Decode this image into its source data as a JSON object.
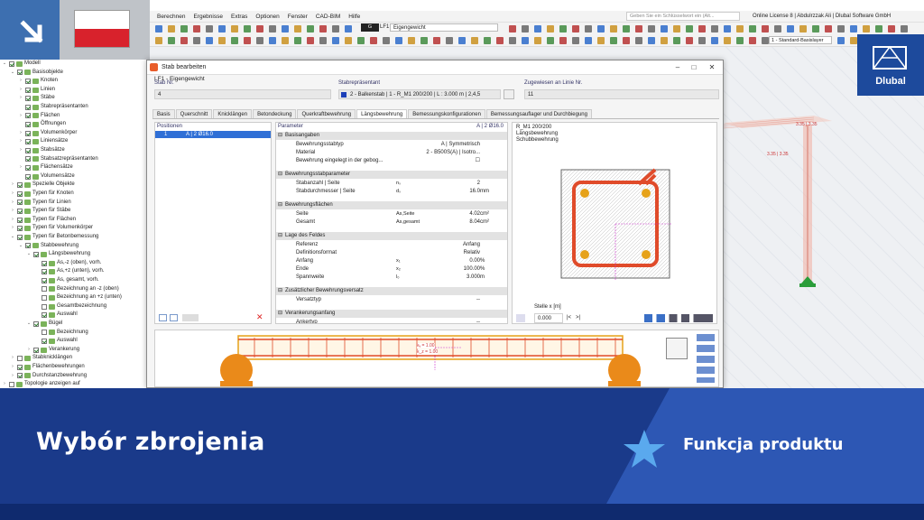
{
  "menu": [
    "Berechnen",
    "Ergebnisse",
    "Extras",
    "Optionen",
    "Fenster",
    "CAD-BIM",
    "Hilfe"
  ],
  "search_placeholder": "Geben Sie ein Schlüsselwort ein (Alt...",
  "license": "Online License 8 | Abdulrzzak Ali | Dlubal Software GmbH",
  "loadcase": {
    "code": "G",
    "name": "LF1",
    "description": "Eigengewicht"
  },
  "basislayer": "1 - Standard-Basislayer",
  "logo_text": "Dlubal",
  "tree": [
    {
      "label": "Modell",
      "level": 0,
      "exp": "v",
      "checked": true
    },
    {
      "label": "Basisobjekte",
      "level": 1,
      "exp": "v",
      "checked": true
    },
    {
      "label": "Knoten",
      "level": 2,
      "exp": ">",
      "checked": true
    },
    {
      "label": "Linien",
      "level": 2,
      "exp": ">",
      "checked": true
    },
    {
      "label": "Stäbe",
      "level": 2,
      "exp": ">",
      "checked": true
    },
    {
      "label": "Stabrepräsentanten",
      "level": 2,
      "exp": "",
      "checked": true
    },
    {
      "label": "Flächen",
      "level": 2,
      "exp": ">",
      "checked": true
    },
    {
      "label": "Öffnungen",
      "level": 2,
      "exp": "",
      "checked": true
    },
    {
      "label": "Volumenkörper",
      "level": 2,
      "exp": ">",
      "checked": true
    },
    {
      "label": "Liniensätze",
      "level": 2,
      "exp": ">",
      "checked": true
    },
    {
      "label": "Stabsätze",
      "level": 2,
      "exp": ">",
      "checked": true
    },
    {
      "label": "Stabsatzrepräsentanten",
      "level": 2,
      "exp": "",
      "checked": true
    },
    {
      "label": "Flächensätze",
      "level": 2,
      "exp": ">",
      "checked": true
    },
    {
      "label": "Volumensätze",
      "level": 2,
      "exp": "",
      "checked": true
    },
    {
      "label": "Spezielle Objekte",
      "level": 1,
      "exp": ">",
      "checked": true
    },
    {
      "label": "Typen für Knoten",
      "level": 1,
      "exp": ">",
      "checked": true
    },
    {
      "label": "Typen für Linien",
      "level": 1,
      "exp": ">",
      "checked": true
    },
    {
      "label": "Typen für Stäbe",
      "level": 1,
      "exp": ">",
      "checked": true
    },
    {
      "label": "Typen für Flächen",
      "level": 1,
      "exp": ">",
      "checked": true
    },
    {
      "label": "Typen für Volumenkörper",
      "level": 1,
      "exp": ">",
      "checked": true
    },
    {
      "label": "Typen für Betonbemessung",
      "level": 1,
      "exp": "v",
      "checked": true
    },
    {
      "label": "Stabbewehrung",
      "level": 2,
      "exp": "v",
      "checked": true
    },
    {
      "label": "Längsbewehrung",
      "level": 3,
      "exp": "v",
      "checked": true
    },
    {
      "label": "As,-z (oben), vorh.",
      "level": 4,
      "exp": "",
      "checked": true
    },
    {
      "label": "As,+z (unten), vorh.",
      "level": 4,
      "exp": "",
      "checked": true
    },
    {
      "label": "As, gesamt, vorh.",
      "level": 4,
      "exp": "",
      "checked": true
    },
    {
      "label": "Bezeichnung an -z (oben)",
      "level": 4,
      "exp": "",
      "checked": false
    },
    {
      "label": "Bezeichnung an +z (unten)",
      "level": 4,
      "exp": "",
      "checked": false
    },
    {
      "label": "Gesamtbezeichnung",
      "level": 4,
      "exp": "",
      "checked": false
    },
    {
      "label": "Auswahl",
      "level": 4,
      "exp": "",
      "checked": true
    },
    {
      "label": "Bügel",
      "level": 3,
      "exp": "v",
      "checked": true
    },
    {
      "label": "Bezeichnung",
      "level": 4,
      "exp": "",
      "checked": false
    },
    {
      "label": "Auswahl",
      "level": 4,
      "exp": "",
      "checked": true
    },
    {
      "label": "Verankerung",
      "level": 3,
      "exp": ">",
      "checked": true
    },
    {
      "label": "Stabknicklängen",
      "level": 1,
      "exp": ">",
      "checked": false
    },
    {
      "label": "Flächenbewehrungen",
      "level": 1,
      "exp": ">",
      "checked": true
    },
    {
      "label": "Durchstanzbewehrung",
      "level": 1,
      "exp": ">",
      "checked": true
    },
    {
      "label": "Topologie anzeigen auf",
      "level": 0,
      "exp": ">",
      "checked": false
    }
  ],
  "dialog": {
    "title": "Stab bearbeiten",
    "subtitle": "LF1 - Eigengewicht",
    "stab_nr_label": "Stab Nr.",
    "stab_nr": "4",
    "stabrep_label": "Stabrepräsentant",
    "stabrep": "2 - Balkenstab | 1 - R_M1 200/200 | L : 3.000 m | 2,4,5",
    "linie_label": "Zugewiesen an Linie Nr.",
    "linie": "11",
    "tabs": [
      "Basis",
      "Querschnitt",
      "Knicklängen",
      "Betondeckung",
      "Querkraftbewehrung",
      "Längsbewehrung",
      "Bemessungskonfigurationen",
      "Bemessungsauflager und Durchbiegung"
    ],
    "active_tab": 5,
    "positions_label": "Positionen",
    "positions": [
      {
        "nr": "1",
        "desc": "A | 2 Ø16.0"
      }
    ],
    "parameter_label": "Parameter",
    "parameter_right": "A | 2 Ø16.0",
    "sections": [
      {
        "title": "Basisangaben",
        "rows": [
          {
            "k": "Bewehrungsstabtyp",
            "s": "",
            "v": "A | Symmetrisch",
            "u": ""
          },
          {
            "k": "Material",
            "s": "",
            "v": "2 - B500S(A) | Isotro...",
            "u": ""
          },
          {
            "k": "Bewehrung eingelegt in der gebog...",
            "s": "",
            "v": "☐",
            "u": ""
          }
        ]
      },
      {
        "title": "Bewehrungsstabparameter",
        "rows": [
          {
            "k": "Stabanzahl | Seite",
            "s": "nₛ",
            "v": "2",
            "u": ""
          },
          {
            "k": "Stabdurchmesser | Seite",
            "s": "dₛ",
            "v": "16.0",
            "u": "mm"
          }
        ]
      },
      {
        "title": "Bewehrungsflächen",
        "rows": [
          {
            "k": "Seite",
            "s": "As,Seite",
            "v": "4.02",
            "u": "cm²"
          },
          {
            "k": "Gesamt",
            "s": "As,gesamt",
            "v": "8.04",
            "u": "cm²"
          }
        ]
      },
      {
        "title": "Lage des Feldes",
        "rows": [
          {
            "k": "Referenz",
            "s": "",
            "v": "Anfang",
            "u": ""
          },
          {
            "k": "Definitionsformat",
            "s": "",
            "v": "Relativ",
            "u": ""
          },
          {
            "k": "Anfang",
            "s": "x₁",
            "v": "0.00",
            "u": "%"
          },
          {
            "k": "Ende",
            "s": "x₂",
            "v": "100.00",
            "u": "%"
          },
          {
            "k": "Spannweite",
            "s": "l₀",
            "v": "3.000",
            "u": "m"
          }
        ]
      },
      {
        "title": "Zusätzlicher Bewehrungsversatz",
        "rows": [
          {
            "k": "Versatztyp",
            "s": "",
            "v": "--",
            "u": ""
          }
        ]
      },
      {
        "title": "Verankerungsanfang",
        "rows": [
          {
            "k": "Ankertyp",
            "s": "",
            "v": "--",
            "u": ""
          }
        ]
      }
    ],
    "preview_lines": [
      "R_M1 200/200",
      "Längsbewehrung",
      "Schubbewehrung"
    ],
    "stelle_label": "Stelle x [m]",
    "stelle_value": "0.000"
  },
  "viewport_labels": [
    "3.35 | 3.35",
    "3.35 | 3.35"
  ],
  "beam_labels": [
    "kᵧ = 1.00",
    "k_z = 1.00"
  ],
  "banner": {
    "title": "Wybór zbrojenia",
    "feature": "Funkcja produktu"
  },
  "colors": {
    "brand_blue": "#1a3a8a",
    "accent_blue": "#2d57b4",
    "rebar_red": "#e04b2a",
    "rebar_orange": "#e6a21a"
  }
}
